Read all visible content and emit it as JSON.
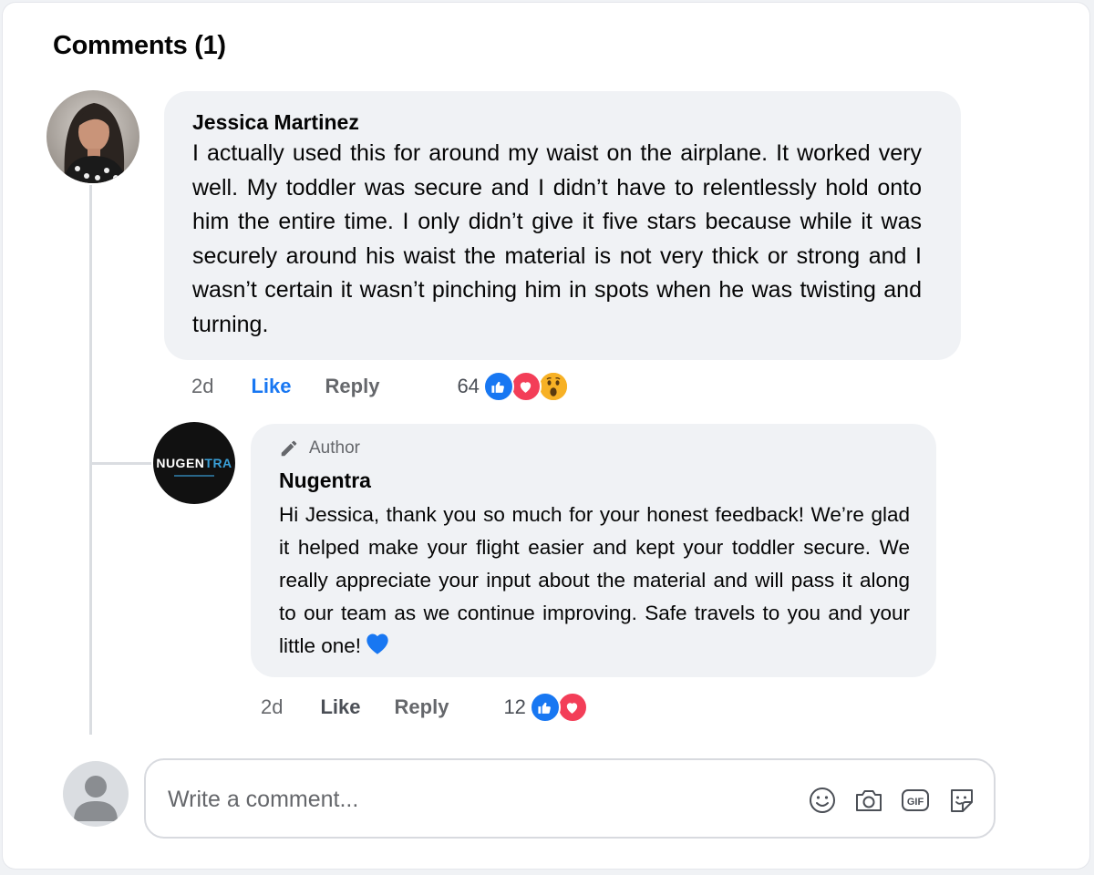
{
  "page": {
    "title": "Comments (1)"
  },
  "comment": {
    "author": "Jessica Martinez",
    "text": "I actually used this for around my waist on the airplane. It worked very well. My toddler was secure and I didn’t have to relentlessly hold onto him the entire time. I only didn’t give it five stars because while it was securely around his waist the material is not very thick or strong and I wasn’t certain it wasn’t pinching him in spots when he was twisting and turning.",
    "time": "2d",
    "like_label": "Like",
    "reply_label": "Reply",
    "reaction_count": "64",
    "reactions": [
      "like-icon",
      "love-icon",
      "wow-icon"
    ],
    "like_active": true
  },
  "reply": {
    "badge": "Author",
    "author": "Nugentra",
    "avatar_logo": {
      "main": "NUGEN",
      "accent": "TRA"
    },
    "text": "Hi Jessica, thank you so much for your honest feedback! We’re glad it helped make your flight easier and kept your toddler secure. We really appreciate your input about the material and will pass it along to our team as we continue improving. Safe travels to you and your little one!",
    "trailing_emoji": "blue-heart-icon",
    "time": "2d",
    "like_label": "Like",
    "reply_label": "Reply",
    "reaction_count": "12",
    "reactions": [
      "like-icon",
      "love-icon"
    ]
  },
  "composer": {
    "placeholder": "Write a comment...",
    "icons": [
      "emoji-icon",
      "camera-icon",
      "gif-icon",
      "sticker-icon"
    ]
  },
  "colors": {
    "accent_blue": "#1877f2",
    "love_red": "#f33e58",
    "wow_yellow": "#f7b125",
    "bubble_bg": "#f0f2f5",
    "secondary_text": "#65676b"
  }
}
